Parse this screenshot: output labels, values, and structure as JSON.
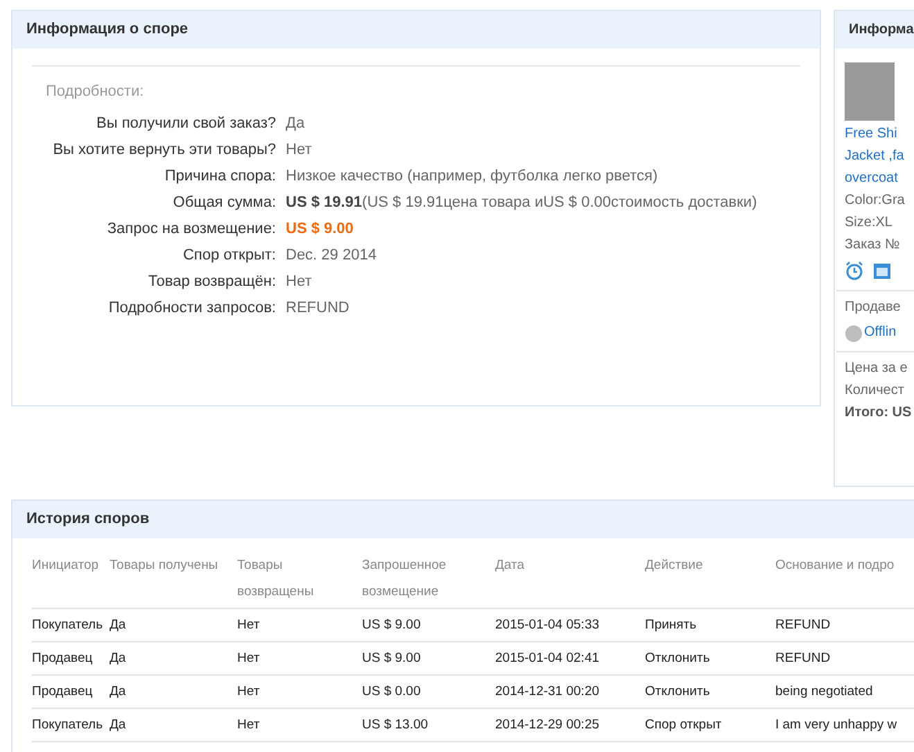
{
  "dispute_info": {
    "title": "Информация о споре",
    "section_label": "Подробности:",
    "rows": [
      {
        "label": "Вы получили свой заказ?",
        "value": "Да",
        "kind": "text"
      },
      {
        "label": "Вы хотите вернуть эти товары?",
        "value": "Нет",
        "kind": "text"
      },
      {
        "label": "Причина спора:",
        "value": "Низкое качество (например, футболка легко рвется)",
        "kind": "text"
      },
      {
        "label": "Общая сумма:",
        "value": "**US $ 19.91**(US $ 19.91цена товара иUS $ 0.00стоимость доставки)",
        "kind": "text"
      },
      {
        "label": "Запрос на возмещение:",
        "value": "US $ 9.00",
        "kind": "highlight"
      },
      {
        "label": "Спор открыт:",
        "value": "Dec. 29 2014",
        "kind": "text"
      },
      {
        "label": "Товар возвращён:",
        "value": "Нет",
        "kind": "text"
      },
      {
        "label": "Подробности запросов:",
        "value": "REFUND",
        "kind": "text"
      }
    ]
  },
  "order_info": {
    "title": "Информа",
    "product_lines": [
      "Free Shi",
      "Jacket ,fa",
      "overcoat"
    ],
    "color_text": "Color:Gra",
    "size": "Size:XL",
    "order_no": "Заказ №",
    "seller_label": "Продаве",
    "seller_status": "Offlin",
    "price_label": "Цена за е",
    "quantity_label": "Количест",
    "total": "Итого: US"
  },
  "history": {
    "title": "История споров",
    "columns": [
      "Инициатор",
      "Товары получены",
      "Товары возвращены",
      "Запрошенное возмещение",
      "Дата",
      "Действие",
      "Основание и подро"
    ],
    "rows": [
      [
        "Покупатель",
        "Да",
        "Нет",
        "US $ 9.00",
        "2015-01-04 05:33",
        "Принять",
        "REFUND"
      ],
      [
        "Продавец",
        "Да",
        "Нет",
        "US $ 9.00",
        "2015-01-04 02:41",
        "Отклонить",
        "REFUND"
      ],
      [
        "Продавец",
        "Да",
        "Нет",
        "US $ 0.00",
        "2014-12-31 00:20",
        "Отклонить",
        "being negotiated"
      ],
      [
        "Покупатель",
        "Да",
        "Нет",
        "US $ 13.00",
        "2014-12-29 00:25",
        "Спор открыт",
        "I am very unhappy w"
      ]
    ]
  }
}
